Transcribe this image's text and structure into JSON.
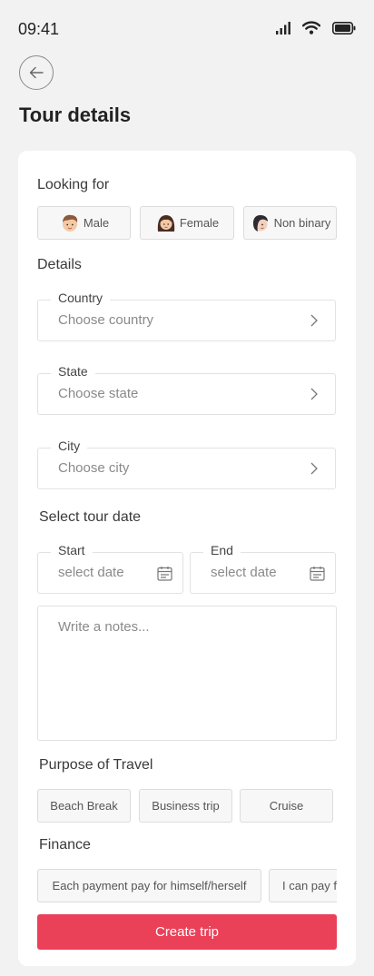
{
  "status_bar": {
    "time": "09:41"
  },
  "header": {
    "title": "Tour details"
  },
  "looking_for": {
    "label": "Looking for",
    "options": [
      {
        "label": "Male",
        "icon": "male-avatar-icon"
      },
      {
        "label": "Female",
        "icon": "female-avatar-icon"
      },
      {
        "label": "Non binary",
        "icon": "non-binary-avatar-icon"
      }
    ]
  },
  "details": {
    "label": "Details",
    "country": {
      "label": "Country",
      "placeholder": "Choose country"
    },
    "state": {
      "label": "State",
      "placeholder": "Choose state"
    },
    "city": {
      "label": "City",
      "placeholder": "Choose city"
    }
  },
  "tour_date": {
    "label": "Select tour date",
    "start": {
      "label": "Start",
      "placeholder": "select date"
    },
    "end": {
      "label": "End",
      "placeholder": "select date"
    }
  },
  "notes": {
    "placeholder": "Write a notes..."
  },
  "purpose": {
    "label": "Purpose of Travel",
    "options": [
      "Beach Break",
      "Business trip",
      "Cruise"
    ]
  },
  "finance": {
    "label": "Finance",
    "options": [
      "Each payment pay for himself/herself",
      "I can pay for all"
    ]
  },
  "cta": {
    "label": "Create trip"
  },
  "colors": {
    "accent": "#ea4058",
    "background": "#f2f2f2",
    "card": "#ffffff"
  }
}
